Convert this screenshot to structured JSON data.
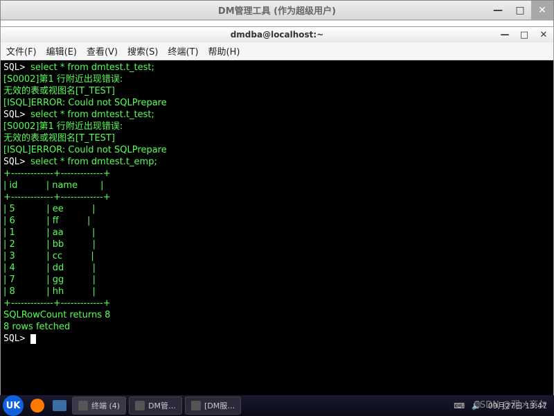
{
  "outer_window": {
    "title": "DM管理工具 (作为超级用户)"
  },
  "terminal": {
    "title": "dmdba@localhost:~",
    "menu": [
      "文件(F)",
      "编辑(E)",
      "查看(V)",
      "搜索(S)",
      "终端(T)",
      "帮助(H)"
    ]
  },
  "session": {
    "prompt": "SQL>",
    "lines": [
      {
        "t": "cmd",
        "text": "select * from dmtest.t_test;"
      },
      {
        "t": "err",
        "text": "[S0002]第1 行附近出现错误:"
      },
      {
        "t": "err",
        "text": "无效的表或视图名[T_TEST]"
      },
      {
        "t": "err",
        "text": "[ISQL]ERROR: Could not SQLPrepare"
      },
      {
        "t": "cmd",
        "text": "select * from dmtest.t_test;"
      },
      {
        "t": "err",
        "text": "[S0002]第1 行附近出现错误:"
      },
      {
        "t": "err",
        "text": "无效的表或视图名[T_TEST]"
      },
      {
        "t": "err",
        "text": "[ISQL]ERROR: Could not SQLPrepare"
      },
      {
        "t": "cmd",
        "text": "select * from dmtest.t_emp;"
      }
    ],
    "table": {
      "columns": [
        "id",
        "name"
      ],
      "rows": [
        {
          "id": "5",
          "name": "ee"
        },
        {
          "id": "6",
          "name": "ff"
        },
        {
          "id": "1",
          "name": "aa"
        },
        {
          "id": "2",
          "name": "bb"
        },
        {
          "id": "3",
          "name": "cc"
        },
        {
          "id": "4",
          "name": "dd"
        },
        {
          "id": "7",
          "name": "gg"
        },
        {
          "id": "8",
          "name": "hh"
        }
      ]
    },
    "footer": [
      "SQLRowCount returns 8",
      "8 rows fetched"
    ]
  },
  "taskbar": {
    "items": [
      {
        "label": "终端 (4)"
      },
      {
        "label": "DM管…"
      },
      {
        "label": "[DM服…"
      }
    ],
    "clock": "09月27日 13:47",
    "watermark": "CSDN @羽㐅商攵"
  }
}
